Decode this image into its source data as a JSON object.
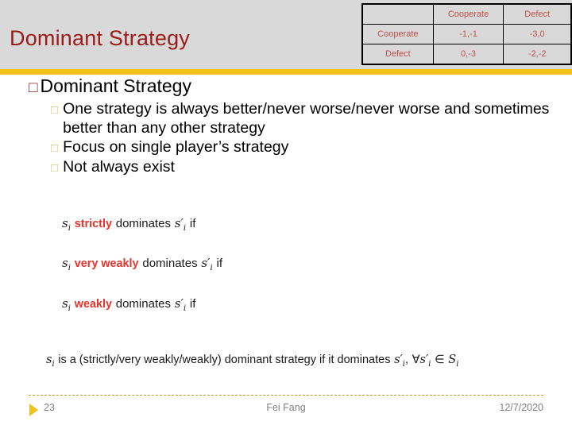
{
  "header": {
    "title": "Dominant Strategy",
    "title_color": "#9c1a18",
    "band_color": "#d9d9d9",
    "rule_color": "#efc31c"
  },
  "payoff_matrix": {
    "corner": "",
    "column_headers": [
      "Cooperate",
      "Defect"
    ],
    "rows": [
      {
        "label": "Cooperate",
        "cells": [
          "-1,-1",
          "-3,0"
        ]
      },
      {
        "label": "Defect",
        "cells": [
          "0,-3",
          "-2,-2"
        ]
      }
    ],
    "text_color": "#c0504d",
    "background": "#d9d9d9"
  },
  "content": {
    "level1": {
      "marker": "□",
      "text": "Dominant Strategy"
    },
    "level2": [
      {
        "marker": "□",
        "text": "One strategy is always better/never worse/never worse and sometimes better than any other strategy"
      },
      {
        "marker": "□",
        "text": "Focus on single player’s strategy"
      },
      {
        "marker": "□",
        "text": "Not always exist"
      }
    ]
  },
  "formulas": {
    "f1": {
      "lhs": "s",
      "lhs_sub": "i",
      "emphasis": "strictly",
      "verb": "dominates",
      "rhs": "s′",
      "rhs_sub": "i",
      "tail": "if",
      "plain_text": "sᵢ strictly dominates s′ᵢ if"
    },
    "f2": {
      "lhs": "s",
      "lhs_sub": "i",
      "emphasis": "very weakly",
      "verb": "dominates",
      "rhs": "s′",
      "rhs_sub": "i",
      "tail": "if",
      "plain_text": "sᵢ very weakly dominates s′ᵢ if"
    },
    "f3": {
      "lhs": "s",
      "lhs_sub": "i",
      "emphasis": "weakly",
      "verb": "dominates",
      "rhs": "s′",
      "rhs_sub": "i",
      "tail": "if",
      "plain_text": "sᵢ weakly dominates s′ᵢ if"
    },
    "f4": {
      "lhs": "s",
      "lhs_sub": "i",
      "body": "is a (strictly/very weakly/weakly) dominant strategy if it dominates",
      "rhs": "s′",
      "rhs_sub": "i",
      "quantifier": "∀",
      "rhs2": "s′",
      "rhs2_sub": "i",
      "member": "∈",
      "set": "S",
      "set_sub": "i",
      "plain_text": "sᵢ is a (strictly/very weakly/weakly) dominant strategy if it dominates s′ᵢ, ∀s′ᵢ ∈ Sᵢ"
    }
  },
  "footer": {
    "page_number": "23",
    "author": "Fei Fang",
    "date": "12/7/2020",
    "rule_color": "#c9a227",
    "triangle_color": "#efc31c",
    "text_color": "#808080"
  }
}
